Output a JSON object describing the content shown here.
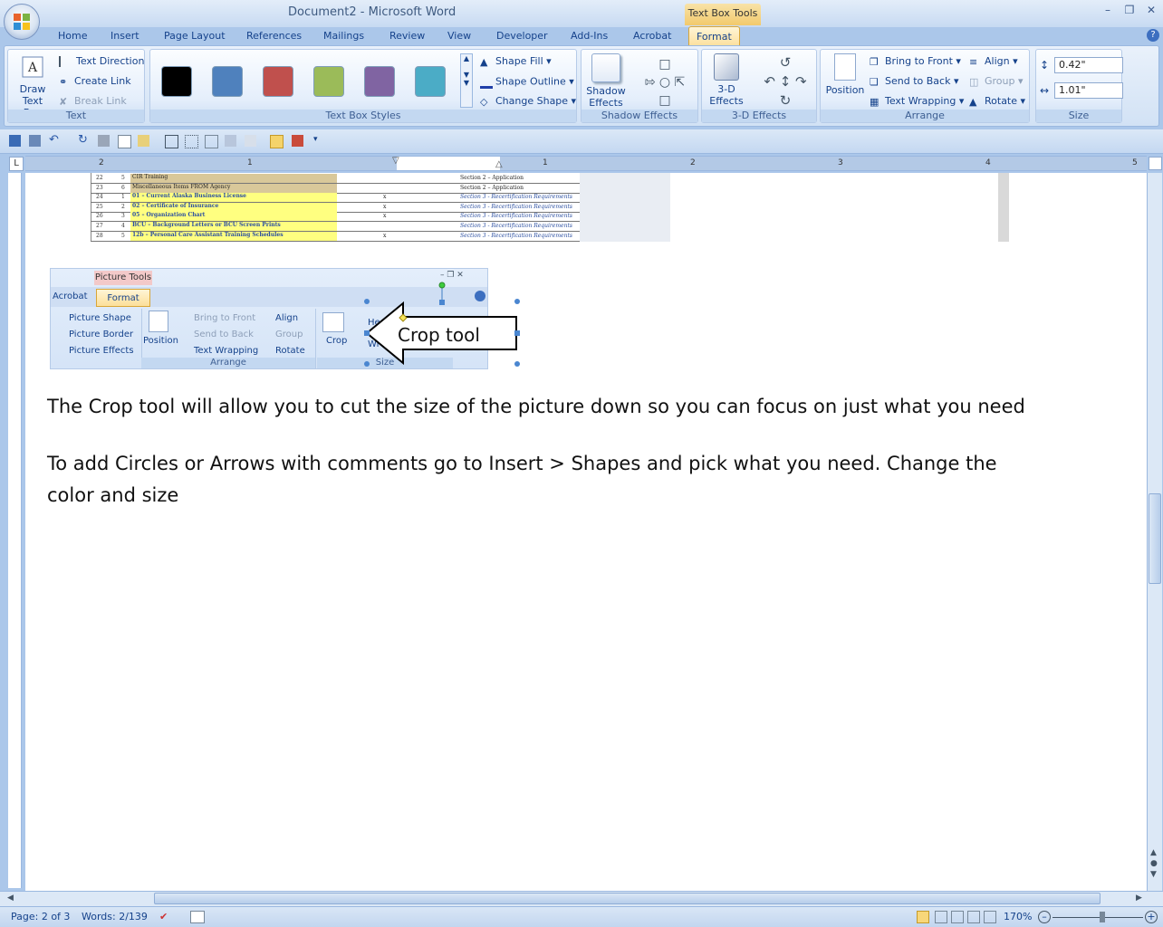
{
  "window": {
    "title": "Document2 - Microsoft Word",
    "contextual_tab_group": "Text Box Tools"
  },
  "tabs": [
    "Home",
    "Insert",
    "Page Layout",
    "References",
    "Mailings",
    "Review",
    "View",
    "Developer",
    "Add-Ins",
    "Acrobat",
    "Format"
  ],
  "ribbon": {
    "text_group": {
      "label": "Text",
      "draw_text_box": "Draw\nText Box",
      "draw_line1": "Draw",
      "draw_line2": "Text Box",
      "text_direction": "Text Direction",
      "create_link": "Create Link",
      "break_link": "Break Link"
    },
    "text_box_styles": {
      "label": "Text Box Styles",
      "swatches": [
        "#000000",
        "#4f81bd",
        "#c0504d",
        "#9bbb59",
        "#8064a2",
        "#4bacc6"
      ],
      "shape_fill": "Shape Fill",
      "shape_outline": "Shape Outline",
      "change_shape": "Change Shape"
    },
    "shadow_effects": {
      "label": "Shadow Effects",
      "button_line1": "Shadow",
      "button_line2": "Effects"
    },
    "three_d": {
      "label": "3-D Effects",
      "button_line1": "3-D",
      "button_line2": "Effects"
    },
    "arrange": {
      "label": "Arrange",
      "position": "Position",
      "bring_to_front": "Bring to Front",
      "send_to_back": "Send to Back",
      "text_wrapping": "Text Wrapping",
      "align": "Align",
      "group": "Group",
      "rotate": "Rotate"
    },
    "size": {
      "label": "Size",
      "height": "0.42\"",
      "width": "1.01\""
    }
  },
  "ruler": {
    "numbers_left": [
      "2",
      "1"
    ],
    "numbers_right": [
      "1",
      "2",
      "3",
      "4",
      "5"
    ]
  },
  "embedded_sheet": {
    "rows": [
      {
        "num": "22",
        "idx": "5",
        "label": "CIR Training",
        "note": "Section 2 – Application",
        "x": ""
      },
      {
        "num": "23",
        "idx": "6",
        "label": "Miscellaneous Items FROM Agency",
        "note": "Section 2 – Application",
        "x": ""
      },
      {
        "num": "24",
        "idx": "1",
        "label": "01 – Current Alaska Business License",
        "note": "Section 3 - Recertification Requirements",
        "x": "x"
      },
      {
        "num": "25",
        "idx": "2",
        "label": "02 – Certificate of Insurance",
        "note": "Section 3 - Recertification Requirements",
        "x": "x"
      },
      {
        "num": "26",
        "idx": "3",
        "label": "05 – Organization Chart",
        "note": "Section 3 - Recertification Requirements",
        "x": "x"
      },
      {
        "num": "27",
        "idx": "4",
        "label": "BCU – Background Letters or BCU Screen Prints",
        "note": "Section 3 - Recertification Requirements",
        "x": ""
      },
      {
        "num": "28",
        "idx": "5",
        "label": "12b – Personal Care Assistant Training Schedules",
        "note": "Section 3 - Recertification Requirements",
        "x": "x"
      }
    ]
  },
  "embedded_ribbon": {
    "context_label": "Picture Tools",
    "tab_acrobat": "Acrobat",
    "tab_format": "Format",
    "picture_shape": "Picture Shape",
    "picture_border": "Picture Border",
    "picture_effects": "Picture Effects",
    "position": "Position",
    "bring_to_front": "Bring to Front",
    "send_to_back": "Send to Back",
    "text_wrapping": "Text Wrapping",
    "align": "Align",
    "group": "Group",
    "rotate": "Rotate",
    "arrange_label": "Arrange",
    "crop": "Crop",
    "size_label": "Size",
    "he_partial": "He",
    "wi_partial": "Wi"
  },
  "callout": {
    "text": "Crop tool"
  },
  "document": {
    "para1": "The Crop tool will allow you to cut the size of the picture down so you can focus on just what you need",
    "para2": "To add Circles or Arrows with comments go to Insert > Shapes and pick what you need. Change the color and size"
  },
  "status": {
    "page": "Page: 2 of 3",
    "words": "Words: 2/139",
    "zoom": "170%"
  }
}
